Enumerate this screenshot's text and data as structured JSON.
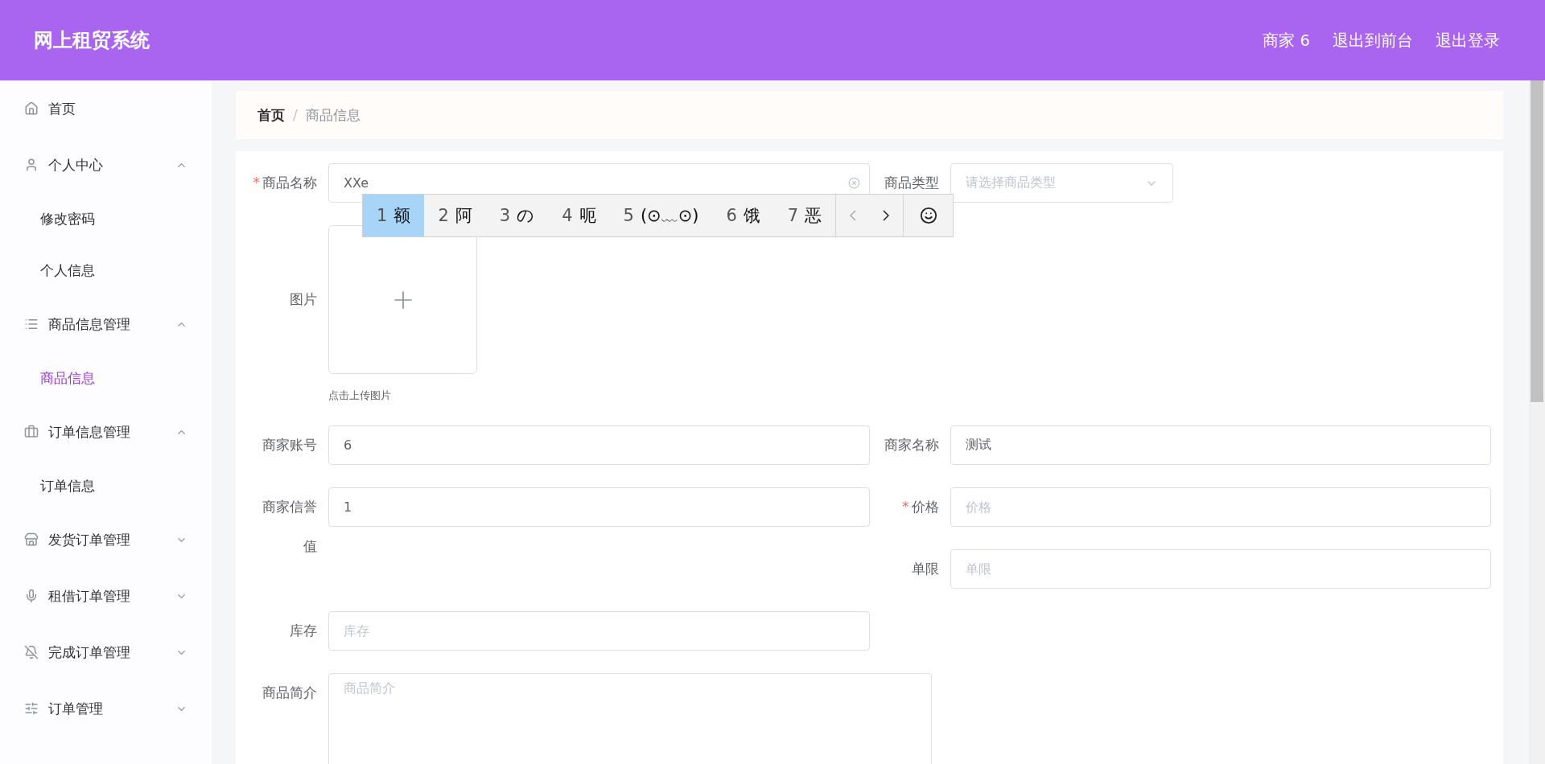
{
  "header": {
    "title": "网上租贸系统",
    "links": [
      "商家 6",
      "退出到前台",
      "退出登录"
    ]
  },
  "sidebar": {
    "items": [
      {
        "kind": "item",
        "label": "首页",
        "selected": false
      },
      {
        "kind": "submenu",
        "label": "个人中心",
        "selected": false,
        "expanded": true,
        "children": [
          {
            "label": "修改密码",
            "selected": false
          },
          {
            "label": "个人信息",
            "selected": false
          }
        ]
      },
      {
        "kind": "submenu",
        "label": "商品信息管理",
        "selected": false,
        "expanded": true,
        "children": [
          {
            "label": "商品信息",
            "selected": true
          }
        ]
      },
      {
        "kind": "submenu",
        "label": "订单信息管理",
        "selected": false,
        "expanded": true,
        "children": [
          {
            "label": "订单信息",
            "selected": false
          }
        ]
      },
      {
        "kind": "submenu",
        "label": "发货订单管理",
        "selected": false,
        "expanded": false
      },
      {
        "kind": "submenu",
        "label": "租借订单管理",
        "selected": false,
        "expanded": false
      },
      {
        "kind": "submenu",
        "label": "完成订单管理",
        "selected": false,
        "expanded": false
      },
      {
        "kind": "submenu",
        "label": "订单管理",
        "selected": false,
        "expanded": false
      }
    ]
  },
  "breadcrumb": [
    {
      "label": "首页"
    },
    {
      "separator": "/",
      "label": "商品信息"
    }
  ],
  "form": {
    "rows": [
      {
        "columns": [
          [
            {
              "kind": "input",
              "required_mark": "*",
              "label": "商品名称",
              "value": "XXe",
              "clearable": true
            }
          ],
          [
            {
              "kind": "select",
              "label": "商品类型",
              "placeholder": "请选择商品类型"
            }
          ]
        ]
      },
      {
        "columns": [
          [
            {
              "kind": "upload",
              "label": "图片",
              "hint": "点击上传图片"
            }
          ]
        ]
      },
      {
        "columns": [
          [
            {
              "kind": "input",
              "label": "商家账号",
              "value": "6"
            }
          ],
          [
            {
              "kind": "input",
              "label": "商家名称",
              "value": "测试"
            }
          ]
        ]
      },
      {
        "columns": [
          [
            {
              "kind": "input",
              "label": "商家信誉值",
              "value": "1"
            }
          ],
          [
            {
              "kind": "input",
              "required_mark": "*",
              "label": "价格",
              "placeholder": "价格"
            },
            {
              "kind": "input",
              "label": "单限",
              "placeholder": "单限"
            }
          ]
        ]
      },
      {
        "columns": [
          [
            {
              "kind": "input",
              "label": "库存",
              "placeholder": "库存"
            }
          ]
        ]
      },
      {
        "columns": [
          [
            {
              "kind": "textarea",
              "label": "商品简介",
              "placeholder": "商品简介"
            }
          ]
        ]
      }
    ]
  },
  "ime": {
    "candidates": [
      {
        "number": "1",
        "text": "额",
        "selected": true
      },
      {
        "number": "2",
        "text": "阿",
        "selected": false
      },
      {
        "number": "3",
        "text": "の",
        "selected": false
      },
      {
        "number": "4",
        "text": "呃",
        "selected": false
      },
      {
        "number": "5",
        "text": "(⊙﹏⊙)",
        "selected": false
      },
      {
        "number": "6",
        "text": "饿",
        "selected": false
      },
      {
        "number": "7",
        "text": "恶",
        "selected": false
      }
    ],
    "prev_disabled": true
  }
}
